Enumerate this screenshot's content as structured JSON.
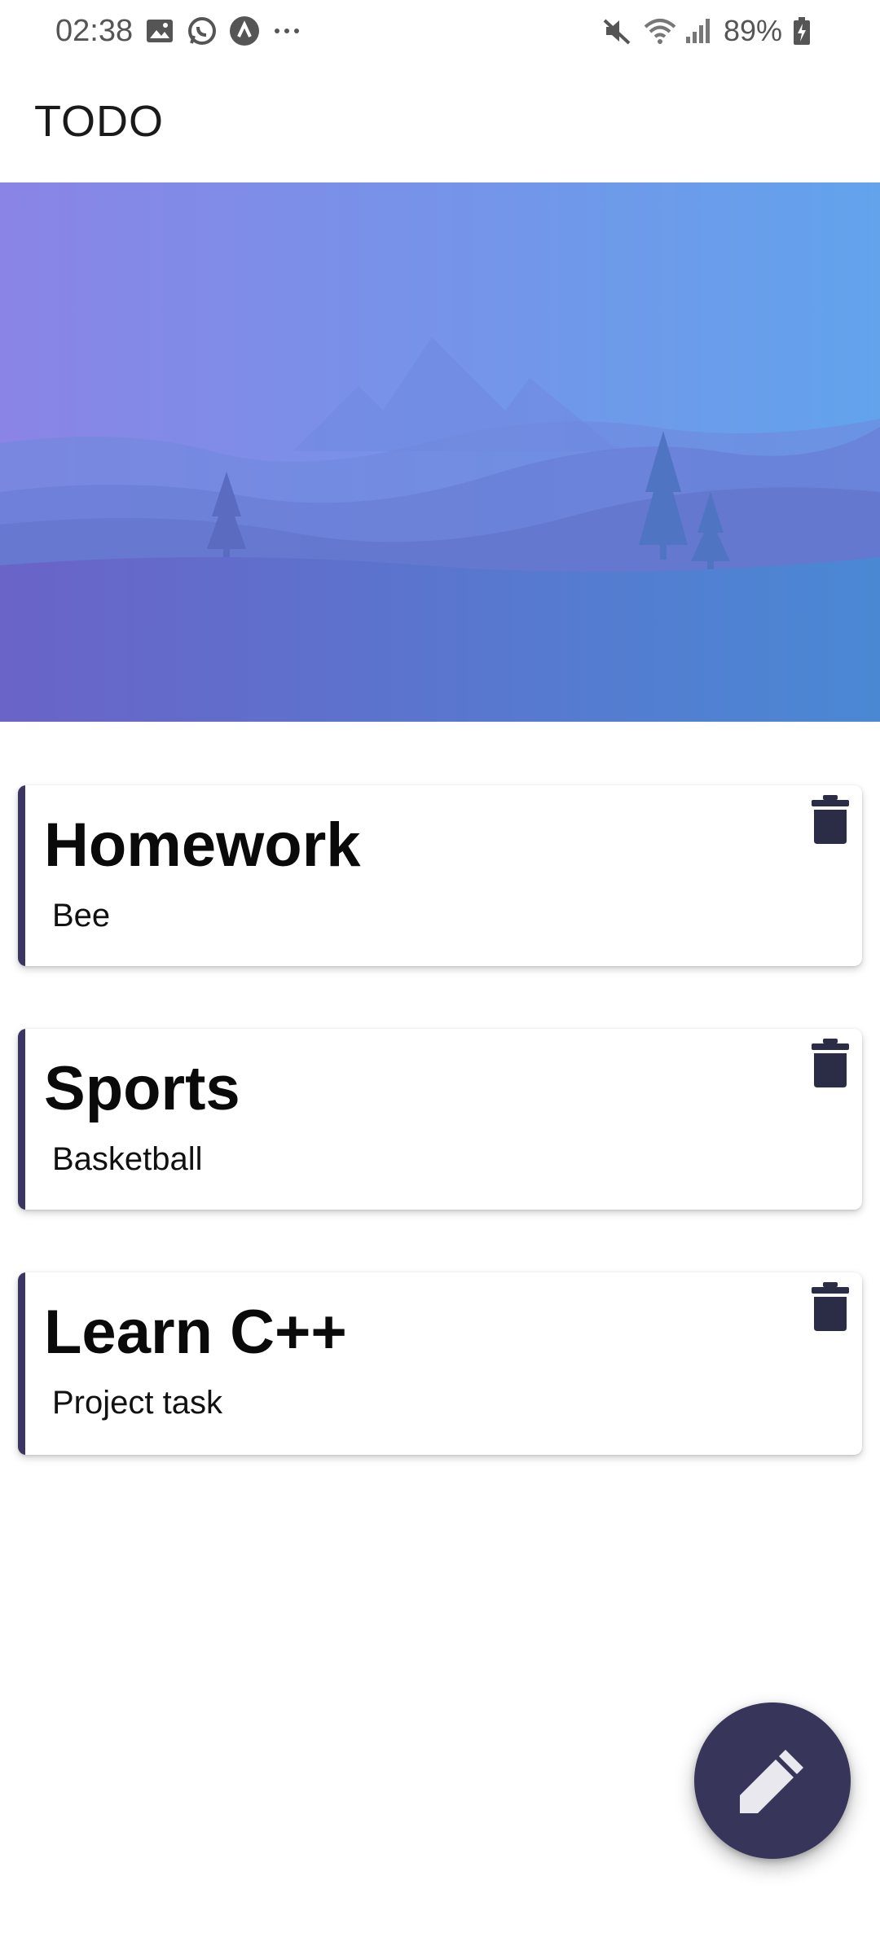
{
  "status_bar": {
    "time": "02:38",
    "left_icons": [
      "image-icon",
      "whatsapp-icon",
      "app-circle-icon",
      "more-dots-icon"
    ],
    "right_icons": [
      "mute-icon",
      "wifi-icon",
      "signal-icon",
      "battery-charging-icon"
    ],
    "battery": "89%"
  },
  "app_bar": {
    "title": "TODO"
  },
  "todos": [
    {
      "title": "Homework",
      "description": "Bee"
    },
    {
      "title": "Sports",
      "description": "Basketball"
    },
    {
      "title": "Learn C++",
      "description": "Project task"
    }
  ],
  "colors": {
    "accent": "#3b3563",
    "fab": "#38355a",
    "hero_left": "#8a84e6",
    "hero_right": "#62a3ec"
  },
  "fab": {
    "icon": "pencil-icon"
  }
}
